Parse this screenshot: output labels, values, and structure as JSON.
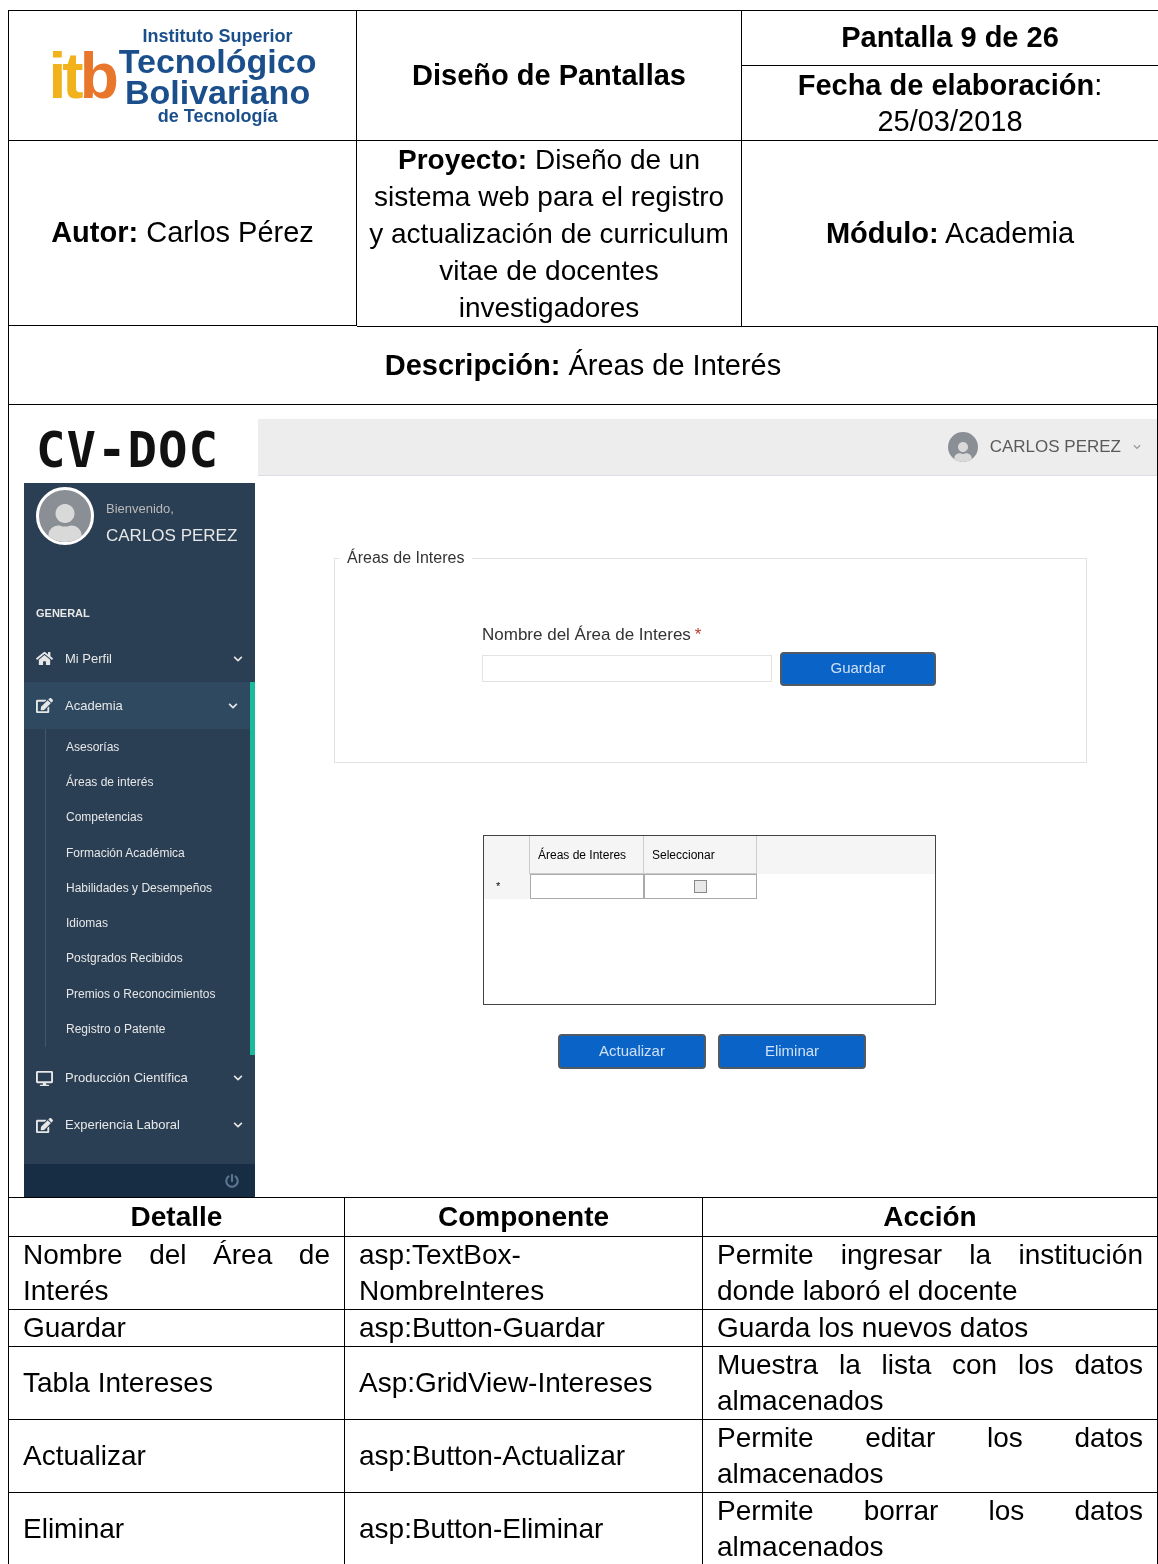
{
  "header": {
    "logo": {
      "mark": "itb",
      "line_1": "Instituto Superior",
      "line_2": "Tecnológico",
      "line_3": "Bolivariano",
      "line_4": "de Tecnología"
    },
    "title": "Diseño de Pantallas",
    "screen_count": "Pantalla 9 de 26",
    "date_label": "**Fecha de elaboración**:",
    "date": "25/03/2018",
    "author": "**Autor:** Carlos Pérez",
    "project": "**Proyecto:** Diseño de un sistema web para el registro y actualización de curriculum vitae de docentes investigadores",
    "module": "**Módulo:** Academia",
    "description": "**Descripción:** Áreas de Interés"
  },
  "app": {
    "brand": "CV-DOC",
    "topbar": {
      "user": "CARLOS PEREZ"
    },
    "sidebar": {
      "welcome": "Bienvenido,",
      "user": "CARLOS PEREZ",
      "section": "GENERAL",
      "items": [
        {
          "label": "Mi Perfil",
          "selected": false,
          "expanded": false
        },
        {
          "label": "Academia",
          "selected": true,
          "expanded": true,
          "children": [
            "Asesorías",
            "Áreas de interés",
            "Competencias",
            "Formación Académica",
            "Habilidades y Desempeños",
            "Idiomas",
            "Postgrados Recibidos",
            "Premios o Reconocimientos",
            "Registro o Patente"
          ]
        },
        {
          "label": "Producción Científica",
          "selected": false,
          "expanded": false
        },
        {
          "label": "Experiencia Laboral",
          "selected": false,
          "expanded": false
        }
      ]
    },
    "form": {
      "legend": "Áreas de Interes",
      "field_label": "Nombre del Área de Interes",
      "required_mark": "*",
      "save_button": "Guardar"
    },
    "grid": {
      "columns": [
        "Áreas de Interes",
        "Seleccionar"
      ],
      "rows": [
        {
          "marker": "*",
          "value": "",
          "checked": false
        }
      ]
    },
    "buttons": [
      "Actualizar",
      "Eliminar"
    ]
  },
  "details": {
    "columns": [
      "Detalle",
      "Componente",
      "Acción"
    ],
    "rows": [
      {
        "detail": "Nombre del Área de Interés",
        "component": "asp:TextBox-NombreInteres",
        "action": "Permite ingresar la institución donde laboró el docente"
      },
      {
        "detail": "Guardar",
        "component": "asp:Button-Guardar",
        "action": "Guarda los nuevos datos"
      },
      {
        "detail": "Tabla Intereses",
        "component": "Asp:GridView-Intereses",
        "action": "Muestra la lista con los datos almacenados"
      },
      {
        "detail": "Actualizar",
        "component": "asp:Button-Actualizar",
        "action": "Permite editar los datos almacenados"
      },
      {
        "detail": "Eliminar",
        "component": "asp:Button-Eliminar",
        "action": "Permite borrar los datos almacenados"
      }
    ]
  }
}
